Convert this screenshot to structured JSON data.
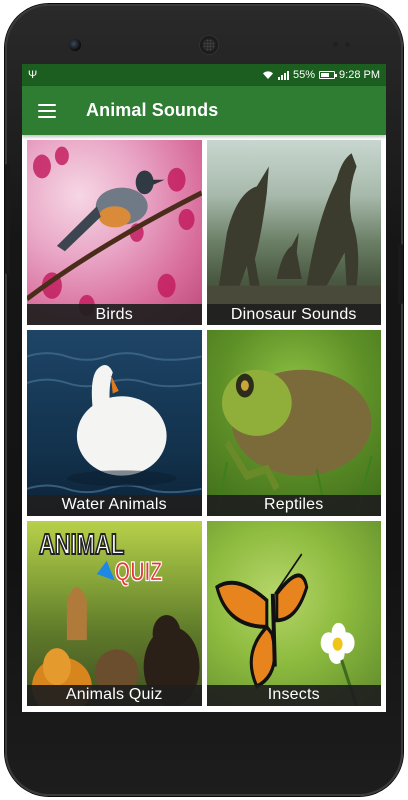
{
  "status_bar": {
    "battery": "55%",
    "time": "9:28 PM",
    "battery_level": 0.55,
    "icons": [
      "usb-icon",
      "wifi-icon",
      "signal-icon",
      "battery-icon"
    ]
  },
  "app_bar": {
    "title": "Animal Sounds",
    "menu_icon": "menu-icon"
  },
  "categories": [
    {
      "label": "Birds"
    },
    {
      "label": "Dinosaur Sounds"
    },
    {
      "label": "Water Animals"
    },
    {
      "label": "Reptiles"
    },
    {
      "label": "Animals Quiz"
    },
    {
      "label": "Insects"
    }
  ],
  "quiz_banner": {
    "word1": "ANIMAL",
    "word2": "QUIZ"
  },
  "colors": {
    "status_bar": "#1b5e20",
    "app_bar": "#2e7d32",
    "label_bg": "#1e1e1e",
    "label_text": "#ffffff"
  }
}
